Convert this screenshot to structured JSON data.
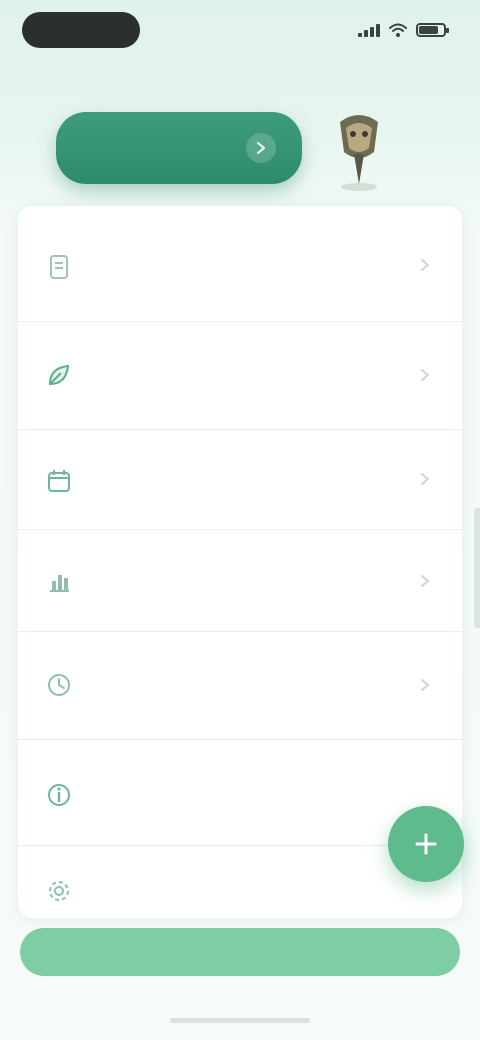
{
  "status_bar": {
    "time": "",
    "signal_bars": 4,
    "battery_level": 0.8
  },
  "header": {
    "subtitle": "",
    "primary_action_label": ""
  },
  "list": {
    "items": [
      {
        "id": "item-1",
        "title": "",
        "subtitle": "",
        "icon": "document-icon"
      },
      {
        "id": "item-2",
        "title": "",
        "subtitle": "",
        "icon": "leaf-icon"
      },
      {
        "id": "item-3",
        "title": "",
        "subtitle": "",
        "icon": "calendar-icon"
      },
      {
        "id": "item-4",
        "title": "",
        "subtitle": "",
        "icon": "chart-icon"
      },
      {
        "id": "item-5",
        "title": "",
        "subtitle": "",
        "icon": "clock-icon"
      },
      {
        "id": "item-6",
        "title": "",
        "subtitle": "",
        "icon": "info-icon"
      },
      {
        "id": "item-7",
        "title": "",
        "subtitle": "",
        "icon": "settings-icon"
      }
    ]
  },
  "fab": {
    "icon": "plus-icon"
  },
  "bottom_bar": {
    "label": ""
  },
  "colors": {
    "primary": "#2e8a6d",
    "accent": "#5dbb8c",
    "bottom_bar": "#7fcda2",
    "background": "#e9f6f0"
  }
}
